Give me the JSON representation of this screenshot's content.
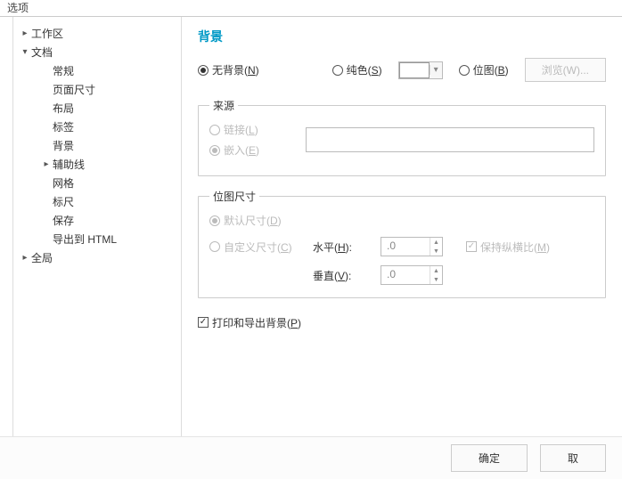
{
  "window_title": "选项",
  "sidebar": {
    "items": [
      {
        "label": "工作区",
        "level": 0,
        "caret": "▸"
      },
      {
        "label": "文档",
        "level": 0,
        "caret": "▾"
      },
      {
        "label": "常规",
        "level": 1,
        "caret": ""
      },
      {
        "label": "页面尺寸",
        "level": 1,
        "caret": ""
      },
      {
        "label": "布局",
        "level": 1,
        "caret": ""
      },
      {
        "label": "标签",
        "level": 1,
        "caret": ""
      },
      {
        "label": "背景",
        "level": 1,
        "caret": ""
      },
      {
        "label": "辅助线",
        "level": 1,
        "caret": "▸"
      },
      {
        "label": "网格",
        "level": 1,
        "caret": ""
      },
      {
        "label": "标尺",
        "level": 1,
        "caret": ""
      },
      {
        "label": "保存",
        "level": 1,
        "caret": ""
      },
      {
        "label": "导出到 HTML",
        "level": 1,
        "caret": ""
      },
      {
        "label": "全局",
        "level": 0,
        "caret": "▸"
      }
    ]
  },
  "heading": "背景",
  "bg_type": {
    "none": {
      "label_pre": "无背景(",
      "mnemonic": "N",
      "label_post": ")",
      "selected": true
    },
    "solid": {
      "label_pre": "纯色(",
      "mnemonic": "S",
      "label_post": ")",
      "selected": false
    },
    "bitmap": {
      "label_pre": "位图(",
      "mnemonic": "B",
      "label_post": ")",
      "selected": false
    },
    "browse": "浏览(W)..."
  },
  "source": {
    "legend": "来源",
    "link": {
      "label_pre": "链接(",
      "mnemonic": "L",
      "label_post": ")"
    },
    "embed": {
      "label_pre": "嵌入(",
      "mnemonic": "E",
      "label_post": ")"
    },
    "path": ""
  },
  "bitmap_size": {
    "legend": "位图尺寸",
    "default": {
      "label_pre": "默认尺寸(",
      "mnemonic": "D",
      "label_post": ")"
    },
    "custom": {
      "label_pre": "自定义尺寸(",
      "mnemonic": "C",
      "label_post": ")"
    },
    "h_label_pre": "水平(",
    "h_mnemonic": "H",
    "h_label_post": "):",
    "v_label_pre": "垂直(",
    "v_mnemonic": "V",
    "v_label_post": "):",
    "h_value": ".0",
    "v_value": ".0",
    "keep_ratio_pre": "保持纵横比(",
    "keep_ratio_mn": "M",
    "keep_ratio_post": ")",
    "keep_ratio_checked": true
  },
  "print_export": {
    "label_pre": "打印和导出背景(",
    "mnemonic": "P",
    "label_post": ")",
    "checked": true
  },
  "footer": {
    "ok": "确定",
    "cancel": "取"
  }
}
